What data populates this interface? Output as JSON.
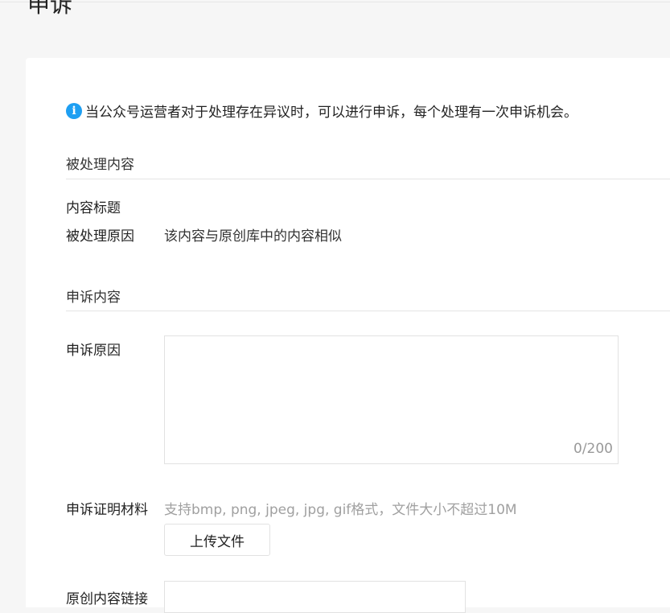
{
  "page": {
    "title": "申诉"
  },
  "notice": {
    "icon": "info-icon",
    "icon_glyph": "i",
    "icon_color": "#1e9ff2",
    "text": "当公众号运营者对于处理存在异议时，可以进行申诉，每个处理有一次申诉机会。"
  },
  "processed_section": {
    "title": "被处理内容",
    "content_title_label": "内容标题",
    "content_title_value": "",
    "reason_label": "被处理原因",
    "reason_value": "该内容与原创库中的内容相似"
  },
  "appeal_section": {
    "title": "申诉内容",
    "reason_label": "申诉原因",
    "reason_value": "",
    "reason_counter": "0/200",
    "evidence_label": "申诉证明材料",
    "evidence_hint": "支持bmp, png, jpeg, jpg, gif格式，文件大小不超过10M",
    "upload_button_label": "上传文件",
    "original_link_label": "原创内容链接",
    "original_link_value": ""
  }
}
